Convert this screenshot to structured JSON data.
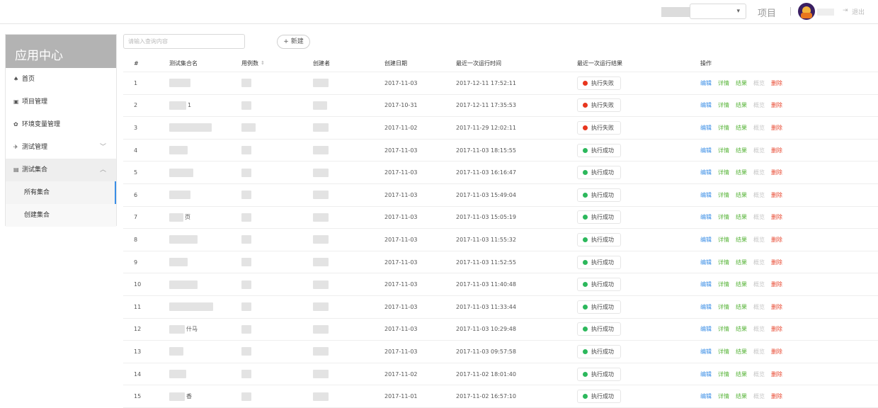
{
  "topbar": {
    "project_select_caret": "▾",
    "project_label": "项目",
    "logout_label": "退出"
  },
  "sidebar": {
    "title": "应用中心",
    "items": [
      {
        "label": "首页",
        "icon": "home-icon",
        "glyph": "♠"
      },
      {
        "label": "项目管理",
        "icon": "project-icon",
        "glyph": "▣"
      },
      {
        "label": "环境变量管理",
        "icon": "gear-icon",
        "glyph": "✿"
      },
      {
        "label": "测试管理",
        "icon": "send-icon",
        "glyph": "✈",
        "chevron": "﹀"
      },
      {
        "label": "测试集合",
        "icon": "collection-icon",
        "glyph": "▤",
        "chevron": "︿"
      }
    ],
    "sub_items": [
      {
        "label": "所有集合"
      },
      {
        "label": "创建集合"
      }
    ]
  },
  "toolbar": {
    "search_placeholder": "请输入查询内容",
    "new_button": "+ 新建"
  },
  "table": {
    "headers": {
      "index": "#",
      "name": "测试集合名",
      "cases": "用例数",
      "creator": "创建者",
      "created_date": "创建日期",
      "last_run_time": "最近一次运行时间",
      "last_run_result": "最近一次运行结果",
      "ops": "操作"
    },
    "ops_labels": {
      "edit": "编辑",
      "detail": "详情",
      "result": "结果",
      "overview": "概览",
      "delete": "删除"
    },
    "status_colors": {
      "fail": "#e8361e",
      "success": "#2cb85c"
    },
    "rows": [
      {
        "index": "1",
        "name_suffix": "",
        "created": "2017-11-03",
        "last_run": "2017-12-11 17:52:11",
        "result": "执行失败",
        "status": "fail"
      },
      {
        "index": "2",
        "name_suffix": "1",
        "created": "2017-10-31",
        "last_run": "2017-12-11 17:35:53",
        "result": "执行失败",
        "status": "fail"
      },
      {
        "index": "3",
        "name_suffix": "",
        "created": "2017-11-02",
        "last_run": "2017-11-29 12:02:11",
        "result": "执行失败",
        "status": "fail"
      },
      {
        "index": "4",
        "name_suffix": "",
        "created": "2017-11-03",
        "last_run": "2017-11-03 18:15:55",
        "result": "执行成功",
        "status": "success"
      },
      {
        "index": "5",
        "name_suffix": "",
        "created": "2017-11-03",
        "last_run": "2017-11-03 16:16:47",
        "result": "执行成功",
        "status": "success"
      },
      {
        "index": "6",
        "name_suffix": "",
        "created": "2017-11-03",
        "last_run": "2017-11-03 15:49:04",
        "result": "执行成功",
        "status": "success"
      },
      {
        "index": "7",
        "name_suffix": "页",
        "created": "2017-11-03",
        "last_run": "2017-11-03 15:05:19",
        "result": "执行成功",
        "status": "success"
      },
      {
        "index": "8",
        "name_suffix": "",
        "created": "2017-11-03",
        "last_run": "2017-11-03 11:55:32",
        "result": "执行成功",
        "status": "success"
      },
      {
        "index": "9",
        "name_suffix": "",
        "created": "2017-11-03",
        "last_run": "2017-11-03 11:52:55",
        "result": "执行成功",
        "status": "success"
      },
      {
        "index": "10",
        "name_suffix": "",
        "created": "2017-11-03",
        "last_run": "2017-11-03 11:40:48",
        "result": "执行成功",
        "status": "success"
      },
      {
        "index": "11",
        "name_suffix": "",
        "created": "2017-11-03",
        "last_run": "2017-11-03 11:33:44",
        "result": "执行成功",
        "status": "success"
      },
      {
        "index": "12",
        "name_suffix": "什马",
        "created": "2017-11-03",
        "last_run": "2017-11-03 10:29:48",
        "result": "执行成功",
        "status": "success"
      },
      {
        "index": "13",
        "name_suffix": "",
        "created": "2017-11-03",
        "last_run": "2017-11-03 09:57:58",
        "result": "执行成功",
        "status": "success"
      },
      {
        "index": "14",
        "name_suffix": "",
        "created": "2017-11-02",
        "last_run": "2017-11-02 18:01:40",
        "result": "执行成功",
        "status": "success"
      },
      {
        "index": "15",
        "name_suffix": "香",
        "created": "2017-11-01",
        "last_run": "2017-11-02 16:57:10",
        "result": "执行成功",
        "status": "success"
      }
    ]
  }
}
